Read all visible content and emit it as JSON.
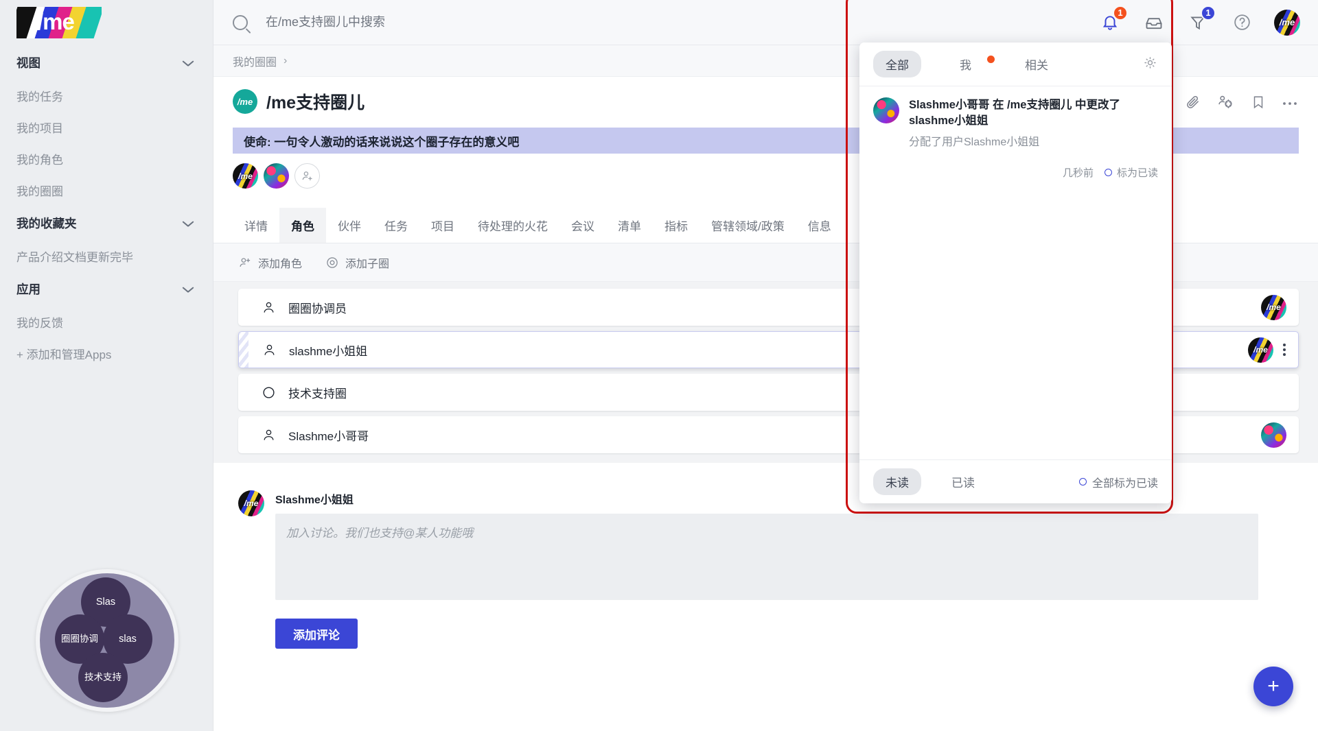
{
  "brand": {
    "logo_text": "/me"
  },
  "sidebar": {
    "groups": [
      {
        "label": "视图",
        "items": [
          {
            "label": "我的任务"
          },
          {
            "label": "我的项目"
          },
          {
            "label": "我的角色"
          },
          {
            "label": "我的圈圈"
          }
        ]
      },
      {
        "label": "我的收藏夹",
        "items": [
          {
            "label": "产品介绍文档更新完毕"
          }
        ]
      },
      {
        "label": "应用",
        "items": [
          {
            "label": "我的反馈"
          },
          {
            "label": "+ 添加和管理Apps"
          }
        ]
      }
    ],
    "circle_widget": {
      "top": "Slas",
      "left": "圈圈协调",
      "right": "slas",
      "bottom": "技术支持"
    }
  },
  "topbar": {
    "search_placeholder": "在/me支持圈儿中搜索",
    "search_value": "",
    "bell_badge": "1",
    "filter_badge": "1",
    "icons": [
      "bell-icon",
      "inbox-icon",
      "filter-icon",
      "help-icon",
      "avatar"
    ]
  },
  "breadcrumb": {
    "root": "我的圈圈",
    "separator": "›"
  },
  "circle": {
    "avatar_text": "/me",
    "title": "/me支持圈儿",
    "mission": "使命: 一句令人激动的话来说说这个圈子存在的意义吧",
    "actions": [
      "attachment-icon",
      "members-settings-icon",
      "bookmark-icon",
      "more-icon"
    ]
  },
  "tabs": [
    {
      "label": "详情",
      "active": false
    },
    {
      "label": "角色",
      "active": true
    },
    {
      "label": "伙伴",
      "active": false
    },
    {
      "label": "任务",
      "active": false
    },
    {
      "label": "项目",
      "active": false
    },
    {
      "label": "待处理的火花",
      "active": false
    },
    {
      "label": "会议",
      "active": false
    },
    {
      "label": "清单",
      "active": false
    },
    {
      "label": "指标",
      "active": false
    },
    {
      "label": "管辖领域/政策",
      "active": false
    },
    {
      "label": "信息",
      "active": false
    }
  ],
  "list_toolbar": {
    "add_role": "添加角色",
    "add_subcircle": "添加子圈"
  },
  "rows": [
    {
      "label": "圈圈协调员",
      "icon": "person-icon",
      "selected": false,
      "avatar": "dark",
      "kebab": false
    },
    {
      "label": "slashme小姐姐",
      "icon": "person-icon",
      "selected": true,
      "avatar": "dark",
      "kebab": true
    },
    {
      "label": "技术支持圈",
      "icon": "circle-icon",
      "selected": false,
      "avatar": "none",
      "kebab": false
    },
    {
      "label": "Slashme小哥哥",
      "icon": "person-icon",
      "selected": false,
      "avatar": "neon",
      "kebab": false
    }
  ],
  "comment": {
    "author": "Slashme小姐姐",
    "placeholder": "加入讨论。我们也支持@某人功能哦",
    "value": "",
    "submit_label": "添加评论"
  },
  "fab": {
    "label": "+"
  },
  "notifications": {
    "tabs": [
      {
        "label": "全部",
        "active": true,
        "dot": false
      },
      {
        "label": "我",
        "active": false,
        "dot": true
      },
      {
        "label": "相关",
        "active": false,
        "dot": false
      }
    ],
    "settings_icon": "gear-icon",
    "items": [
      {
        "title": "Slashme小哥哥 在 /me支持圈儿 中更改了 slashme小姐姐",
        "subtitle": "分配了用户Slashme小姐姐",
        "time": "几秒前",
        "mark_label": "标为已读"
      }
    ],
    "footer": {
      "unread": "未读",
      "read": "已读",
      "mark_all": "全部标为已读"
    }
  },
  "colors": {
    "accent_blue": "#3b46d6",
    "badge_orange": "#f4511e",
    "mission_banner": "#c5c8ef",
    "highlight_red": "#cc1111",
    "sidebar_bg": "#eceef1",
    "teal_avatar": "#15a89a"
  }
}
